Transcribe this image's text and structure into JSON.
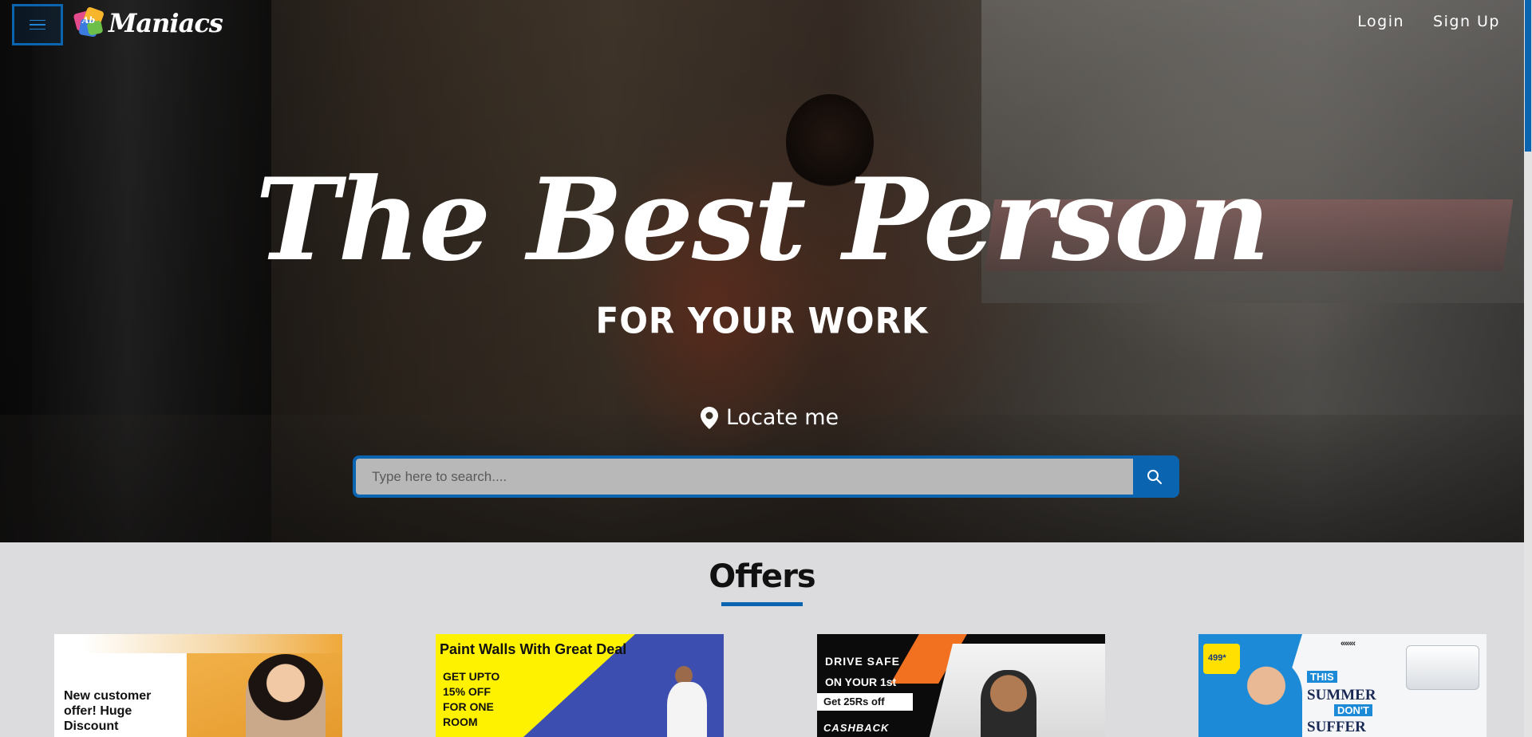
{
  "header": {
    "menu_icon": "hamburger-menu-icon",
    "logo_text": "Maniacs",
    "logo_mark_letters": "Ab",
    "nav": {
      "login": "Login",
      "signup": "Sign Up"
    }
  },
  "hero": {
    "title": "The Best Person",
    "subtitle": "FOR YOUR WORK",
    "locate_label": "Locate me",
    "locate_icon": "map-pin-icon",
    "search_placeholder": "Type here to search....",
    "search_icon": "search-icon"
  },
  "offers": {
    "heading": "Offers",
    "cards": [
      {
        "text": "New customer offer! Huge Discount"
      },
      {
        "title": "Paint Walls With Great Deal",
        "text": "GET UPTO 15% OFF FOR ONE ROOM"
      },
      {
        "line1": "DRIVE SAFE",
        "line2": "ON YOUR 1st",
        "line3": "Get 25Rs off",
        "line4": "CASHBACK"
      },
      {
        "badge": "499*",
        "chevrons": "«««‹",
        "this": "THIS",
        "summer": "SUMMER",
        "dont": "DON'T",
        "suffer": "SUFFER"
      }
    ]
  },
  "colors": {
    "accent": "#0b64b0",
    "offers_bg": "#dcdcde"
  }
}
